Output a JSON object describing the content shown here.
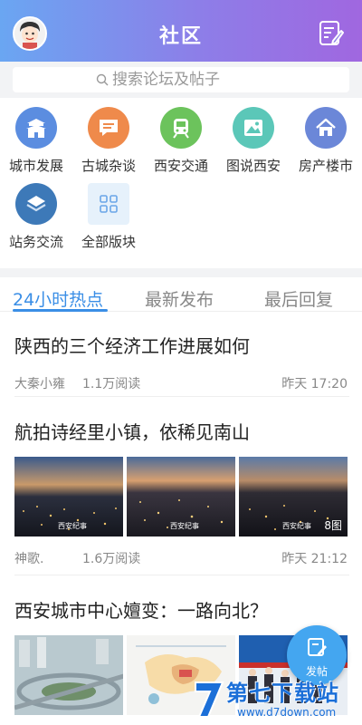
{
  "header": {
    "title": "社区",
    "avatar_icon": "avatar-icon",
    "post_icon": "edit-note-icon",
    "gradient": [
      "#6aa6f2",
      "#a067e0"
    ]
  },
  "search": {
    "placeholder": "搜索论坛及帖子",
    "icon": "search-icon"
  },
  "categories": [
    {
      "label": "城市发展",
      "icon": "city-gate-icon",
      "color": "#5b8de0"
    },
    {
      "label": "古城杂谈",
      "icon": "chat-bubble-icon",
      "color": "#ef8a4b"
    },
    {
      "label": "西安交通",
      "icon": "train-icon",
      "color": "#6cc35c"
    },
    {
      "label": "图说西安",
      "icon": "image-icon",
      "color": "#5bc7b8"
    },
    {
      "label": "房产楼市",
      "icon": "house-icon",
      "color": "#6b87d8"
    },
    {
      "label": "站务交流",
      "icon": "layers-icon",
      "color": "#3d79b8"
    },
    {
      "label": "全部版块",
      "icon": "grid-icon",
      "color": "#e6f1fb"
    }
  ],
  "tabs": [
    {
      "label": "24小时热点",
      "active": true
    },
    {
      "label": "最新发布",
      "active": false
    },
    {
      "label": "最后回复",
      "active": false
    }
  ],
  "posts": [
    {
      "title": "陕西的三个经济工作进展如何",
      "author": "大秦小雍",
      "reads": "1.1万阅读",
      "time": "昨天 17:20"
    },
    {
      "title": "航拍诗经里小镇，依稀见南山",
      "author": "神歌.",
      "reads": "1.6万阅读",
      "time": "昨天 21:12",
      "image_count": "8图",
      "watermark": "西安纪事"
    },
    {
      "title": "西安城市中心嬗变：一路向北？"
    }
  ],
  "fab": {
    "label": "发帖",
    "icon": "compose-icon"
  },
  "watermark": {
    "big": "第七下载站",
    "small": "www.d7down.com"
  },
  "accent": "#3a8ee6"
}
